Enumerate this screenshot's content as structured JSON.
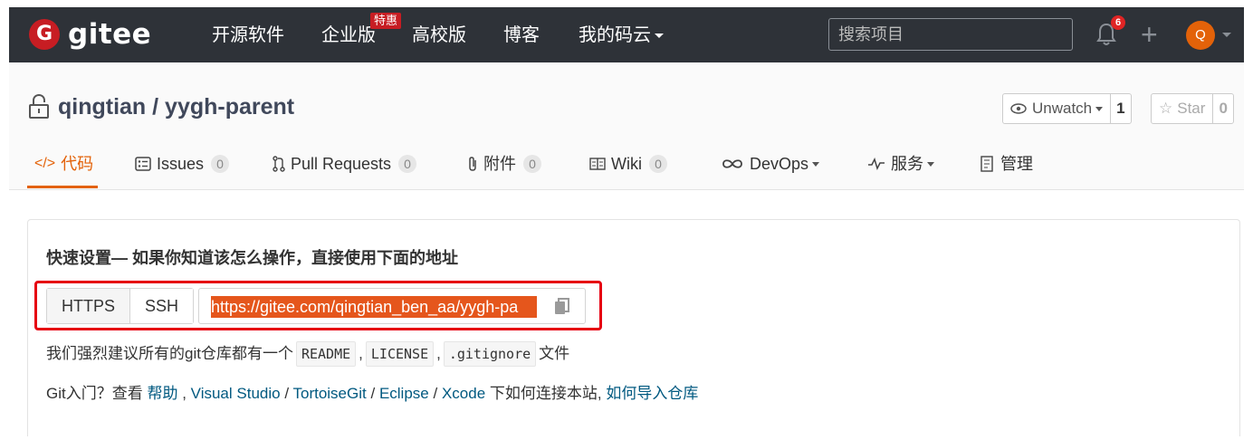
{
  "navbar": {
    "brand": "gitee",
    "logo_letter": "G",
    "items": [
      "开源软件",
      "企业版",
      "高校版",
      "博客",
      "我的码云"
    ],
    "hot_badge": "特惠",
    "search_placeholder": "搜索项目",
    "notification_count": "6",
    "plus": "+",
    "avatar_letter": "Q"
  },
  "repo": {
    "title": "qingtian / yygh-parent",
    "watch_label": "Unwatch",
    "watch_count": "1",
    "star_label": "Star",
    "star_count": "0"
  },
  "tabs": [
    {
      "icon": "</>",
      "label": "代码"
    },
    {
      "label": "Issues",
      "count": "0"
    },
    {
      "label": "Pull Requests",
      "count": "0"
    },
    {
      "label": "附件",
      "count": "0"
    },
    {
      "label": "Wiki",
      "count": "0"
    },
    {
      "label": "DevOps"
    },
    {
      "label": "服务"
    },
    {
      "label": "管理"
    }
  ],
  "setup": {
    "title": "快速设置— 如果你知道该怎么操作，直接使用下面的地址",
    "protocols": [
      "HTTPS",
      "SSH"
    ],
    "url": "https://gitee.com/qingtian_ben_aa/yygh-pa",
    "suggest_prefix": "我们强烈建议所有的git仓库都有一个",
    "files": [
      "README",
      "LICENSE",
      ".gitignore"
    ],
    "comma": ",",
    "suggest_suffix": "文件",
    "help_prefix": "Git入门？查看",
    "help_link": "帮助",
    "tools": [
      "Visual Studio",
      "TortoiseGit",
      "Eclipse",
      "Xcode"
    ],
    "sep": "/",
    "help_mid": "下如何连接本站,",
    "import_link": "如何导入仓库"
  },
  "colors": {
    "navbar_bg": "#2e3238",
    "brand_red": "#c71d23",
    "accent_orange": "#e36209",
    "highlight": "#e5561c",
    "link": "#005980",
    "frame_red": "#e60012"
  }
}
